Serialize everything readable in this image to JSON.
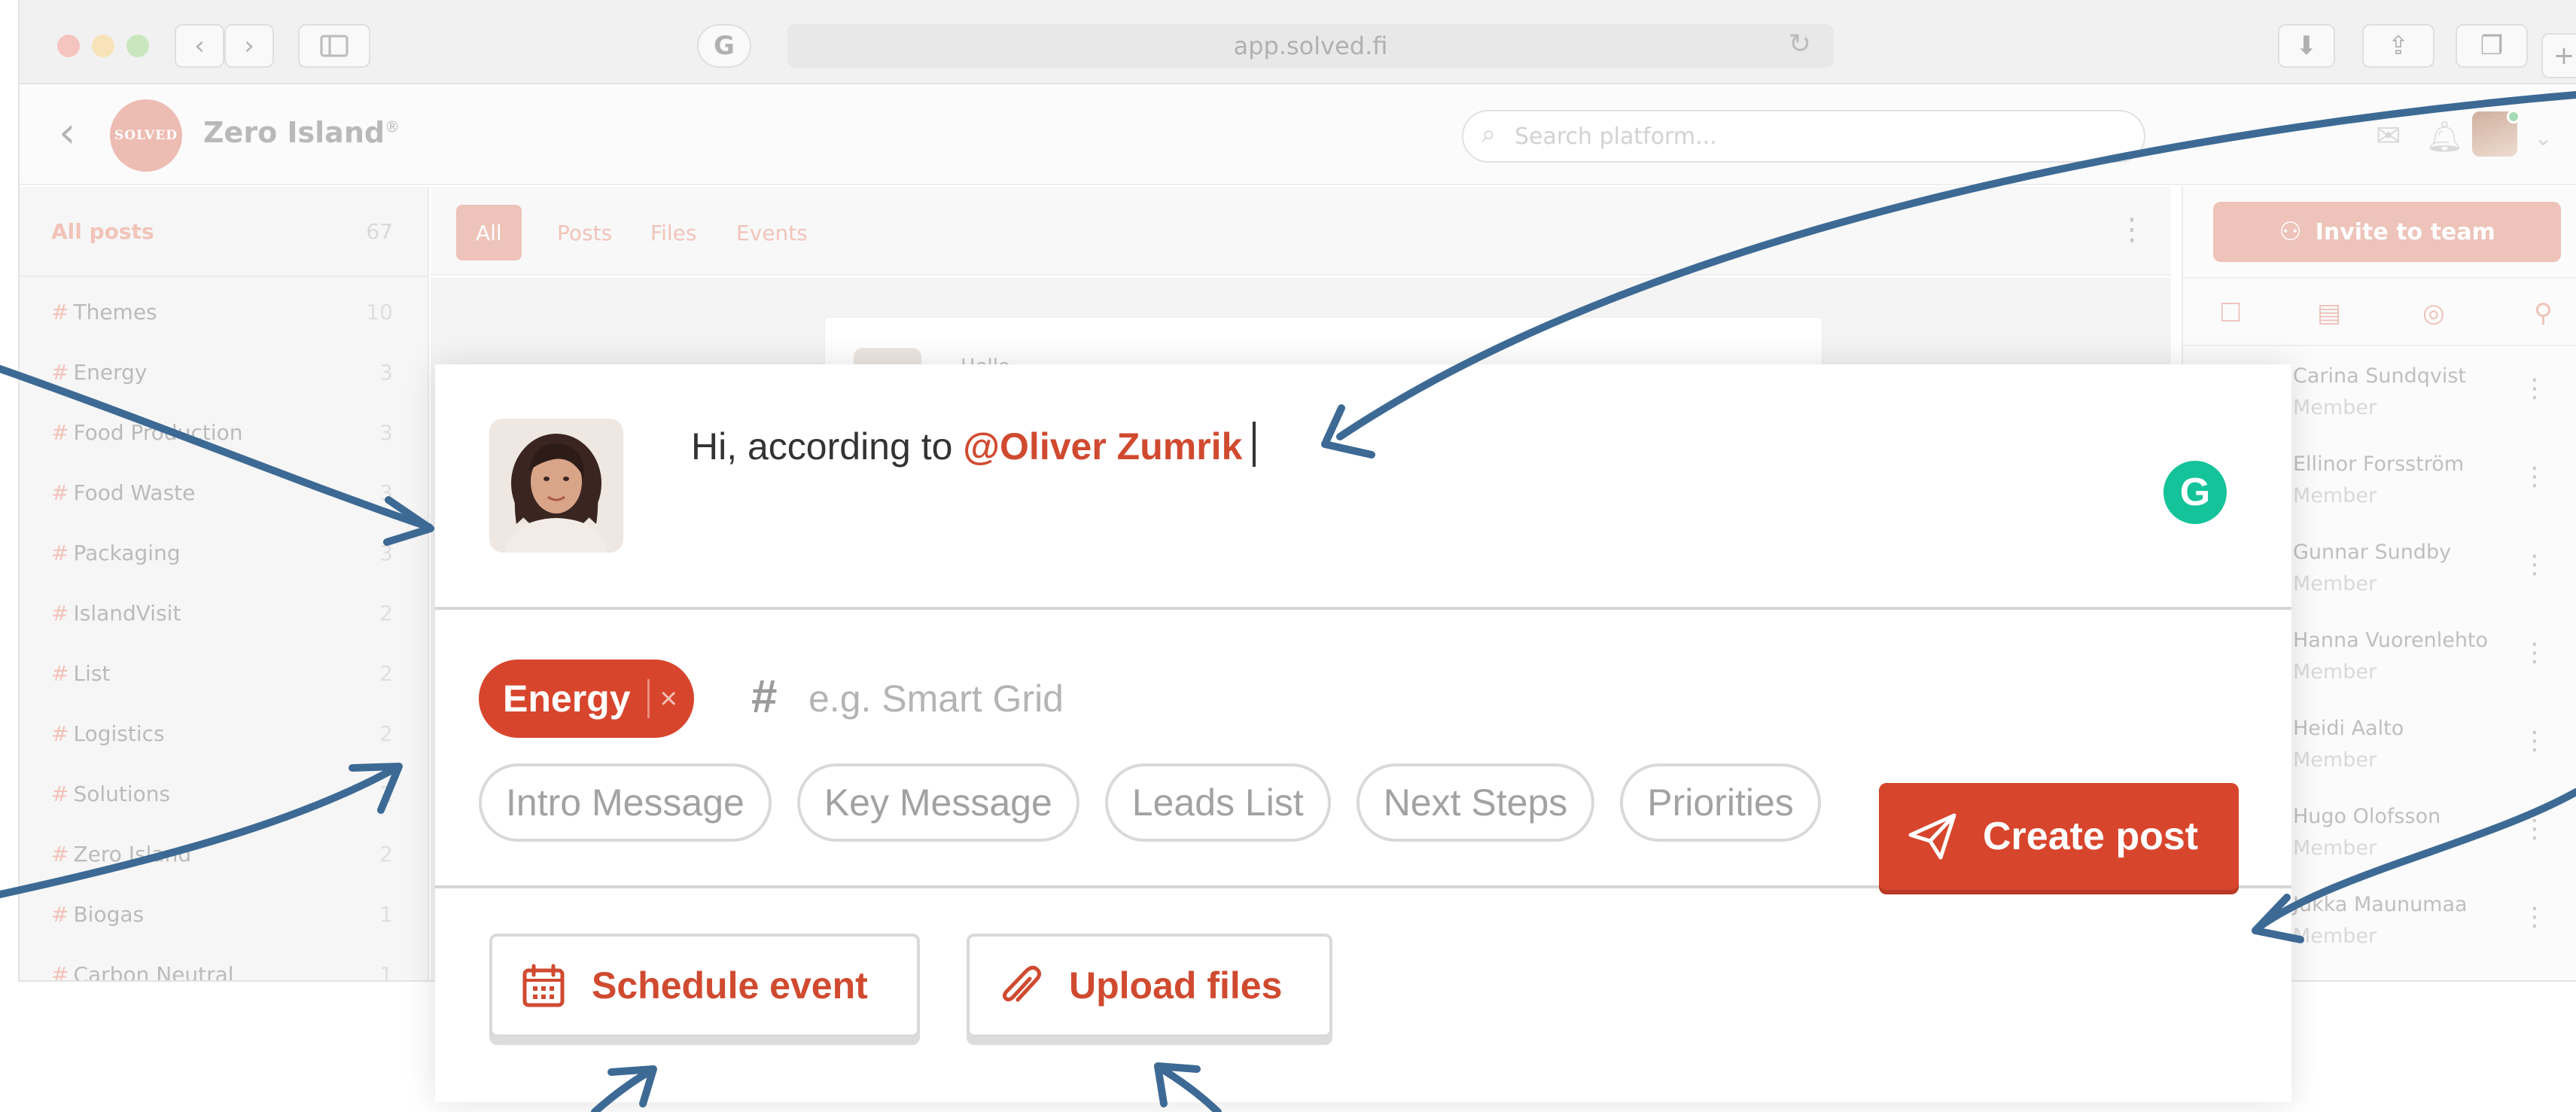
{
  "browser": {
    "url": "app.solved.fi",
    "nav_back": "‹",
    "nav_forward": "›"
  },
  "app": {
    "logo_text": "SOLVED",
    "workspace_name": "Zero Island",
    "workspace_mark": "®",
    "search_placeholder": "Search platform..."
  },
  "sidebar": {
    "all_posts_label": "All posts",
    "all_posts_count": "67",
    "items": [
      {
        "label": "Themes",
        "count": "10"
      },
      {
        "label": "Energy",
        "count": "3"
      },
      {
        "label": "Food Production",
        "count": "3"
      },
      {
        "label": "Food Waste",
        "count": "3"
      },
      {
        "label": "Packaging",
        "count": "3"
      },
      {
        "label": "IslandVisit",
        "count": "2"
      },
      {
        "label": "List",
        "count": "2"
      },
      {
        "label": "Logistics",
        "count": "2"
      },
      {
        "label": "Solutions",
        "count": "2"
      },
      {
        "label": "Zero Island",
        "count": "2"
      },
      {
        "label": "Biogas",
        "count": "1"
      },
      {
        "label": "Carbon Neutral",
        "count": "1"
      }
    ]
  },
  "filters": {
    "tabs": [
      "All",
      "Posts",
      "Files",
      "Events"
    ],
    "active": "All"
  },
  "feed": {
    "preview_text": "Hello"
  },
  "right_panel": {
    "invite_label": "Invite to team",
    "members": [
      {
        "name": "Carina Sundqvist",
        "role": "Member"
      },
      {
        "name": "Ellinor Forsström",
        "role": "Member"
      },
      {
        "name": "Gunnar Sundby",
        "role": "Member"
      },
      {
        "name": "Hanna Vuorenlehto",
        "role": "Member"
      },
      {
        "name": "Heidi Aalto",
        "role": "Member"
      },
      {
        "name": "Hugo Olofsson",
        "role": "Member"
      },
      {
        "name": "Jukka Maunumaa",
        "role": "Member"
      }
    ]
  },
  "composer": {
    "text_before": "Hi, according to ",
    "mention": "@Oliver Zumrik",
    "grammarly_letter": "G",
    "selected_tag": "Energy",
    "tag_remove": "×",
    "tag_placeholder": "e.g. Smart Grid",
    "suggestions": [
      "Intro Message",
      "Key Message",
      "Leads List",
      "Next Steps",
      "Priorities"
    ],
    "schedule_label": "Schedule event",
    "upload_label": "Upload files",
    "create_label": "Create post"
  },
  "colors": {
    "brand_red": "#d8452d",
    "mention_red": "#d04a30",
    "arrow_blue": "#3d6a94",
    "grammarly_green": "#15c39a"
  }
}
